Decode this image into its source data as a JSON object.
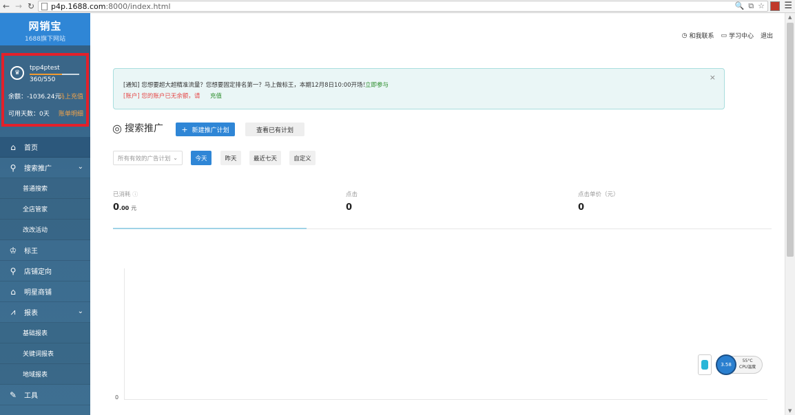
{
  "browser": {
    "url_host": "p4p.1688.com",
    "url_rest": ":8000/index.html",
    "menu_glyph": "☰"
  },
  "sidebar": {
    "logo_title": "网销宝",
    "logo_sub": "1688旗下网站",
    "account": {
      "username": "tpp4ptest",
      "level": "360/550",
      "level_progress": 0.65,
      "balance": "余额：-1036.24元",
      "recharge": "马上充值",
      "days": "可用天数：0天",
      "bill": "账单明细"
    },
    "menu": [
      {
        "label": "首页",
        "icon": "home-icon",
        "active": true
      },
      {
        "label": "搜索推广",
        "icon": "search-icon",
        "expandable": true
      },
      {
        "label": "普通搜索",
        "sub": true
      },
      {
        "label": "全店管家",
        "sub": true
      },
      {
        "label": "改改活动",
        "sub": true
      },
      {
        "label": "标王",
        "icon": "crown-icon"
      },
      {
        "label": "店铺定向",
        "icon": "location-pin-icon"
      },
      {
        "label": "明星商铺",
        "icon": "shop-icon"
      },
      {
        "label": "报表",
        "icon": "chart-line-icon",
        "expandable": true
      },
      {
        "label": "基础报表",
        "sub": true
      },
      {
        "label": "关键词报表",
        "sub": true
      },
      {
        "label": "地域报表",
        "sub": true
      },
      {
        "label": "工具",
        "icon": "wrench-icon"
      }
    ]
  },
  "header": {
    "contact": "和我联系",
    "learn": "学习中心",
    "logout": "退出"
  },
  "notice": {
    "line1": "[通知]  您想要超大超精准流量？您想要固定排名第一？马上做标王，本期12月8日10:00开场！",
    "line1_link": "立即参与",
    "line2": "[账户]  您的账户已无余额，请",
    "line2_link": "充值",
    "close": "×"
  },
  "search_section": {
    "title": "搜索推广",
    "new_plan": "新建推广计划",
    "view_plans": "查看已有计划"
  },
  "filters": {
    "plan_placeholder": "所有有效的广告计划",
    "ranges": [
      "今天",
      "昨天",
      "最近七天",
      "自定义"
    ],
    "selected_range": "今天"
  },
  "stats": {
    "spent_label": "已消耗",
    "spent_int": "0",
    "spent_dec": ".00",
    "spent_unit": "元",
    "clicks_label": "点击",
    "clicks_value": "0",
    "cpc_label": "点击单价（元）",
    "cpc_value": "0"
  },
  "chart": {
    "y_zero": "0"
  },
  "widget": {
    "speed": "3.58",
    "temp": "55°C",
    "temp_label": "CPU温度"
  }
}
